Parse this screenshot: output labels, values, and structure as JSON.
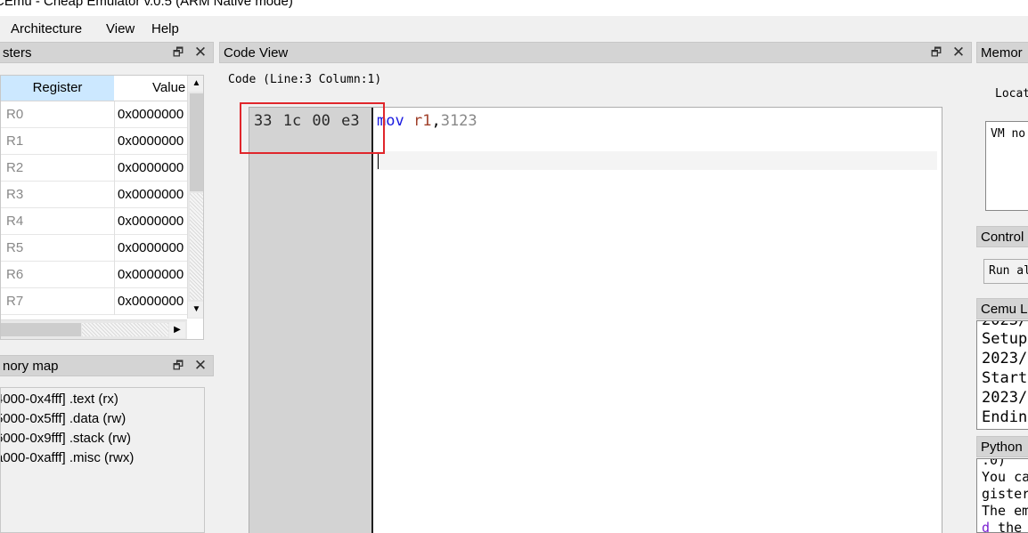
{
  "window": {
    "title": "CEmu - Cheap Emulator v.0.5 (ARM Native mode)"
  },
  "menu": {
    "items": [
      "Architecture",
      "View",
      "Help"
    ]
  },
  "registers_panel": {
    "title": "sters",
    "header": {
      "register": "Register",
      "value": "Value"
    },
    "rows": [
      {
        "name": "R0",
        "value": "0x0000000"
      },
      {
        "name": "R1",
        "value": "0x0000000"
      },
      {
        "name": "R2",
        "value": "0x0000000"
      },
      {
        "name": "R3",
        "value": "0x0000000"
      },
      {
        "name": "R4",
        "value": "0x0000000"
      },
      {
        "name": "R5",
        "value": "0x0000000"
      },
      {
        "name": "R6",
        "value": "0x0000000"
      },
      {
        "name": "R7",
        "value": "0x0000000"
      }
    ]
  },
  "memory_map_panel": {
    "title": "nory map",
    "entries": [
      "4000-0x4fff] .text (rx)",
      "5000-0x5fff] .data (rw)",
      "6000-0x9fff] .stack (rw)",
      "a000-0xafff] .misc (rwx)"
    ]
  },
  "code_view": {
    "title": "Code View",
    "cursor_label": "Code (Line:3 Column:1)",
    "gutter_bytes": "33 1c 00 e3",
    "line1": {
      "keyword": "mov",
      "register": "r1",
      "comma": ",",
      "number": "3123"
    }
  },
  "memory_panel": {
    "title": "Memor",
    "location_label": "Locat",
    "vm_text": "VM no"
  },
  "control_panel": {
    "title": "Control",
    "run_button": "Run al"
  },
  "log_panel": {
    "title": "Cemu L",
    "lines": [
      "2023/",
      "Setup",
      "2023/",
      "Start",
      "2023/",
      "Endin"
    ]
  },
  "python_panel": {
    "title": "Python",
    "lines": [
      ".0)",
      "You ca",
      "gister",
      "The em"
    ],
    "last_line": {
      "purple": "d",
      "rest": " the"
    }
  },
  "icons": {
    "float": "restore-icon",
    "close": "close-icon"
  }
}
